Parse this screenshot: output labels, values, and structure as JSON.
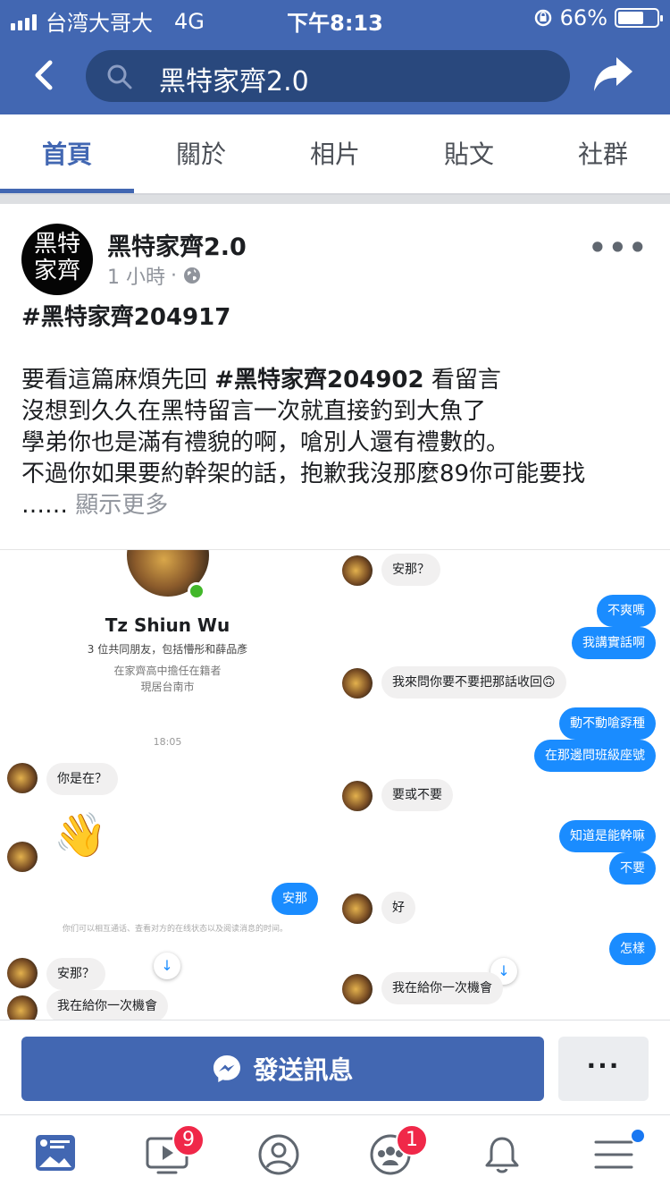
{
  "status_bar": {
    "carrier": "台湾大哥大",
    "network": "4G",
    "time": "下午8:13",
    "battery": "66%",
    "battery_level": 0.66
  },
  "nav": {
    "search_text": "黑特家齊2.0"
  },
  "tabs": [
    {
      "label": "首頁",
      "active": true
    },
    {
      "label": "關於",
      "active": false
    },
    {
      "label": "相片",
      "active": false
    },
    {
      "label": "貼文",
      "active": false
    },
    {
      "label": "社群",
      "active": false
    }
  ],
  "post": {
    "avatar_text": [
      "黑特",
      "家齊"
    ],
    "page_name": "黑特家齊2.0",
    "time": "1 小時",
    "dot": "·",
    "hashtag": "#黑特家齊204917",
    "line2_pre": "要看這篇麻煩先回 ",
    "line2_tag": "#黑特家齊204902",
    "line2_post": " 看留言",
    "line3": "沒想到久久在黑特留言一次就直接釣到大魚了",
    "line4": "學弟你也是滿有禮貌的啊，嗆別人還有禮數的。",
    "line5": "不過你如果要約幹架的話，抱歉我沒那麼89你可能要找",
    "ellipsis": "……",
    "see_more": "顯示更多"
  },
  "screenshot_left": {
    "profile_name": "Tz Shiun Wu",
    "mutual": "3 位共同朋友，包括懵彤和薛品彥",
    "school": "在家齊高中擔任在籍者",
    "city": "現居台南市",
    "timestamp": "18:05",
    "msg1": "你是在？",
    "msg_out": "安那",
    "notice": "你们可以相互通话、查看对方的在线状态以及阅读消息的时间。",
    "msg2": "安那？",
    "msg3": "我在給你一次機會"
  },
  "screenshot_right": {
    "msg1": "安那？",
    "out1": "不爽嗎",
    "out2": "我講實話啊",
    "msg2": "我來問你要不要把那話收回🙃",
    "out3": "動不動嗆孬種",
    "out4": "在那邊問班級座號",
    "msg3": "要或不要",
    "out5": "知道是能幹嘛",
    "out6": "不要",
    "msg4": "好",
    "out7": "怎樣",
    "msg5": "我在給你一次機會"
  },
  "action_bar": {
    "message_label": "發送訊息",
    "more_label": "···"
  },
  "bottom_nav": {
    "watch_badge": "9",
    "groups_badge": "1"
  },
  "colors": {
    "fb_blue": "#4267b2",
    "messenger_blue": "#1a8cff",
    "badge_red": "#f02849"
  }
}
